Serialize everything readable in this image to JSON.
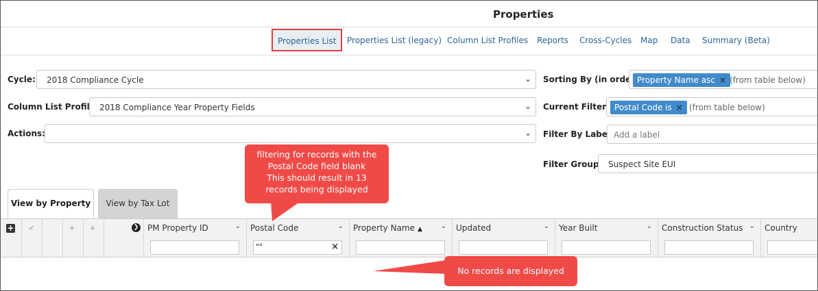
{
  "title": "Properties",
  "nav": {
    "items": [
      {
        "label": "Properties List",
        "active": true
      },
      {
        "label": "Properties List (legacy)"
      },
      {
        "label": "Column List Profiles"
      },
      {
        "label": "Reports"
      },
      {
        "label": "Cross-Cycles"
      },
      {
        "label": "Map"
      },
      {
        "label": "Data"
      },
      {
        "label": "Summary (Beta)"
      }
    ]
  },
  "form": {
    "cycle_label": "Cycle:",
    "cycle_value": "2018 Compliance Cycle",
    "profile_label": "Column List Profile:",
    "profile_value": "2018 Compliance Year Property Fields",
    "actions_label": "Actions:",
    "actions_value": "",
    "sorting_label": "Sorting By (in order):",
    "sorting_tag": "Property Name asc",
    "sorting_hint": "(from table below)",
    "filters_label": "Current Filters:",
    "filters_tag": "Postal Code is",
    "filters_hint": "(from table below)",
    "filter_label_label": "Filter By Label:",
    "filter_label_placeholder": "Add a label",
    "filter_group_label": "Filter Group:",
    "filter_group_value": "Suspect Site EUI"
  },
  "callouts": {
    "filter_note_lines": [
      "filtering for records with the",
      "Postal Code field blank",
      "This should result in 13",
      "records being displayed"
    ],
    "no_records": "No records are displayed"
  },
  "tabs": [
    {
      "label": "View by Property",
      "active": true
    },
    {
      "label": "View by Tax Lot",
      "active": false
    }
  ],
  "grid": {
    "columns": [
      {
        "label": "PM Property ID",
        "filter": ""
      },
      {
        "label": "Postal Code",
        "filter": "\"\""
      },
      {
        "label": "Property Name",
        "filter": "",
        "sort": "asc"
      },
      {
        "label": "Updated",
        "filter": ""
      },
      {
        "label": "Year Built",
        "filter": ""
      },
      {
        "label": "Construction Status",
        "filter": ""
      },
      {
        "label": "Country",
        "filter": ""
      }
    ]
  },
  "colors": {
    "accent": "#428bca",
    "callout": "#f04a48",
    "nav_link": "#2a6496",
    "active_border": "#e03e3e"
  }
}
